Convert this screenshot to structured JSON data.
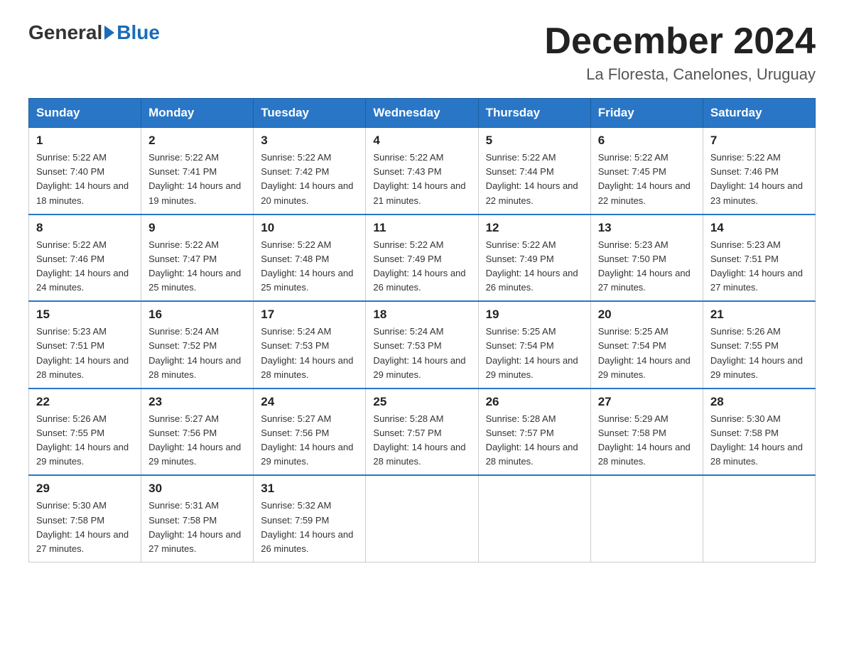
{
  "header": {
    "logo_general": "General",
    "logo_blue": "Blue",
    "month_title": "December 2024",
    "location": "La Floresta, Canelones, Uruguay"
  },
  "weekdays": [
    "Sunday",
    "Monday",
    "Tuesday",
    "Wednesday",
    "Thursday",
    "Friday",
    "Saturday"
  ],
  "weeks": [
    [
      {
        "day": "1",
        "sunrise": "5:22 AM",
        "sunset": "7:40 PM",
        "daylight": "14 hours and 18 minutes."
      },
      {
        "day": "2",
        "sunrise": "5:22 AM",
        "sunset": "7:41 PM",
        "daylight": "14 hours and 19 minutes."
      },
      {
        "day": "3",
        "sunrise": "5:22 AM",
        "sunset": "7:42 PM",
        "daylight": "14 hours and 20 minutes."
      },
      {
        "day": "4",
        "sunrise": "5:22 AM",
        "sunset": "7:43 PM",
        "daylight": "14 hours and 21 minutes."
      },
      {
        "day": "5",
        "sunrise": "5:22 AM",
        "sunset": "7:44 PM",
        "daylight": "14 hours and 22 minutes."
      },
      {
        "day": "6",
        "sunrise": "5:22 AM",
        "sunset": "7:45 PM",
        "daylight": "14 hours and 22 minutes."
      },
      {
        "day": "7",
        "sunrise": "5:22 AM",
        "sunset": "7:46 PM",
        "daylight": "14 hours and 23 minutes."
      }
    ],
    [
      {
        "day": "8",
        "sunrise": "5:22 AM",
        "sunset": "7:46 PM",
        "daylight": "14 hours and 24 minutes."
      },
      {
        "day": "9",
        "sunrise": "5:22 AM",
        "sunset": "7:47 PM",
        "daylight": "14 hours and 25 minutes."
      },
      {
        "day": "10",
        "sunrise": "5:22 AM",
        "sunset": "7:48 PM",
        "daylight": "14 hours and 25 minutes."
      },
      {
        "day": "11",
        "sunrise": "5:22 AM",
        "sunset": "7:49 PM",
        "daylight": "14 hours and 26 minutes."
      },
      {
        "day": "12",
        "sunrise": "5:22 AM",
        "sunset": "7:49 PM",
        "daylight": "14 hours and 26 minutes."
      },
      {
        "day": "13",
        "sunrise": "5:23 AM",
        "sunset": "7:50 PM",
        "daylight": "14 hours and 27 minutes."
      },
      {
        "day": "14",
        "sunrise": "5:23 AM",
        "sunset": "7:51 PM",
        "daylight": "14 hours and 27 minutes."
      }
    ],
    [
      {
        "day": "15",
        "sunrise": "5:23 AM",
        "sunset": "7:51 PM",
        "daylight": "14 hours and 28 minutes."
      },
      {
        "day": "16",
        "sunrise": "5:24 AM",
        "sunset": "7:52 PM",
        "daylight": "14 hours and 28 minutes."
      },
      {
        "day": "17",
        "sunrise": "5:24 AM",
        "sunset": "7:53 PM",
        "daylight": "14 hours and 28 minutes."
      },
      {
        "day": "18",
        "sunrise": "5:24 AM",
        "sunset": "7:53 PM",
        "daylight": "14 hours and 29 minutes."
      },
      {
        "day": "19",
        "sunrise": "5:25 AM",
        "sunset": "7:54 PM",
        "daylight": "14 hours and 29 minutes."
      },
      {
        "day": "20",
        "sunrise": "5:25 AM",
        "sunset": "7:54 PM",
        "daylight": "14 hours and 29 minutes."
      },
      {
        "day": "21",
        "sunrise": "5:26 AM",
        "sunset": "7:55 PM",
        "daylight": "14 hours and 29 minutes."
      }
    ],
    [
      {
        "day": "22",
        "sunrise": "5:26 AM",
        "sunset": "7:55 PM",
        "daylight": "14 hours and 29 minutes."
      },
      {
        "day": "23",
        "sunrise": "5:27 AM",
        "sunset": "7:56 PM",
        "daylight": "14 hours and 29 minutes."
      },
      {
        "day": "24",
        "sunrise": "5:27 AM",
        "sunset": "7:56 PM",
        "daylight": "14 hours and 29 minutes."
      },
      {
        "day": "25",
        "sunrise": "5:28 AM",
        "sunset": "7:57 PM",
        "daylight": "14 hours and 28 minutes."
      },
      {
        "day": "26",
        "sunrise": "5:28 AM",
        "sunset": "7:57 PM",
        "daylight": "14 hours and 28 minutes."
      },
      {
        "day": "27",
        "sunrise": "5:29 AM",
        "sunset": "7:58 PM",
        "daylight": "14 hours and 28 minutes."
      },
      {
        "day": "28",
        "sunrise": "5:30 AM",
        "sunset": "7:58 PM",
        "daylight": "14 hours and 28 minutes."
      }
    ],
    [
      {
        "day": "29",
        "sunrise": "5:30 AM",
        "sunset": "7:58 PM",
        "daylight": "14 hours and 27 minutes."
      },
      {
        "day": "30",
        "sunrise": "5:31 AM",
        "sunset": "7:58 PM",
        "daylight": "14 hours and 27 minutes."
      },
      {
        "day": "31",
        "sunrise": "5:32 AM",
        "sunset": "7:59 PM",
        "daylight": "14 hours and 26 minutes."
      },
      null,
      null,
      null,
      null
    ]
  ]
}
